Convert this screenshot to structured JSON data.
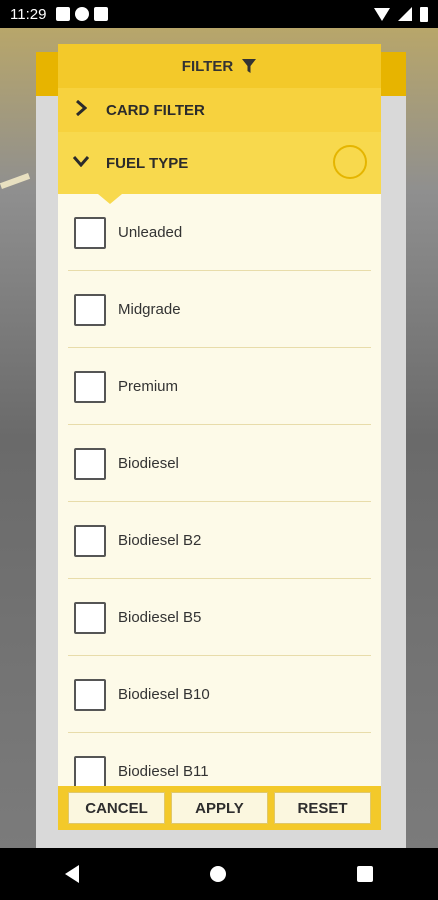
{
  "status_bar": {
    "time": "11:29"
  },
  "modal": {
    "title": "FILTER",
    "card_filter_label": "CARD FILTER",
    "fuel_type_label": "FUEL TYPE",
    "options": [
      {
        "label": "Unleaded",
        "checked": false
      },
      {
        "label": "Midgrade",
        "checked": false
      },
      {
        "label": "Premium",
        "checked": false
      },
      {
        "label": "Biodiesel",
        "checked": false
      },
      {
        "label": "Biodiesel B2",
        "checked": false
      },
      {
        "label": "Biodiesel B5",
        "checked": false
      },
      {
        "label": "Biodiesel B10",
        "checked": false
      },
      {
        "label": "Biodiesel B11",
        "checked": false
      }
    ],
    "buttons": {
      "cancel": "CANCEL",
      "apply": "APPLY",
      "reset": "RESET"
    }
  },
  "colors": {
    "accent": "#f3c92a",
    "panel": "#fdfae8"
  }
}
